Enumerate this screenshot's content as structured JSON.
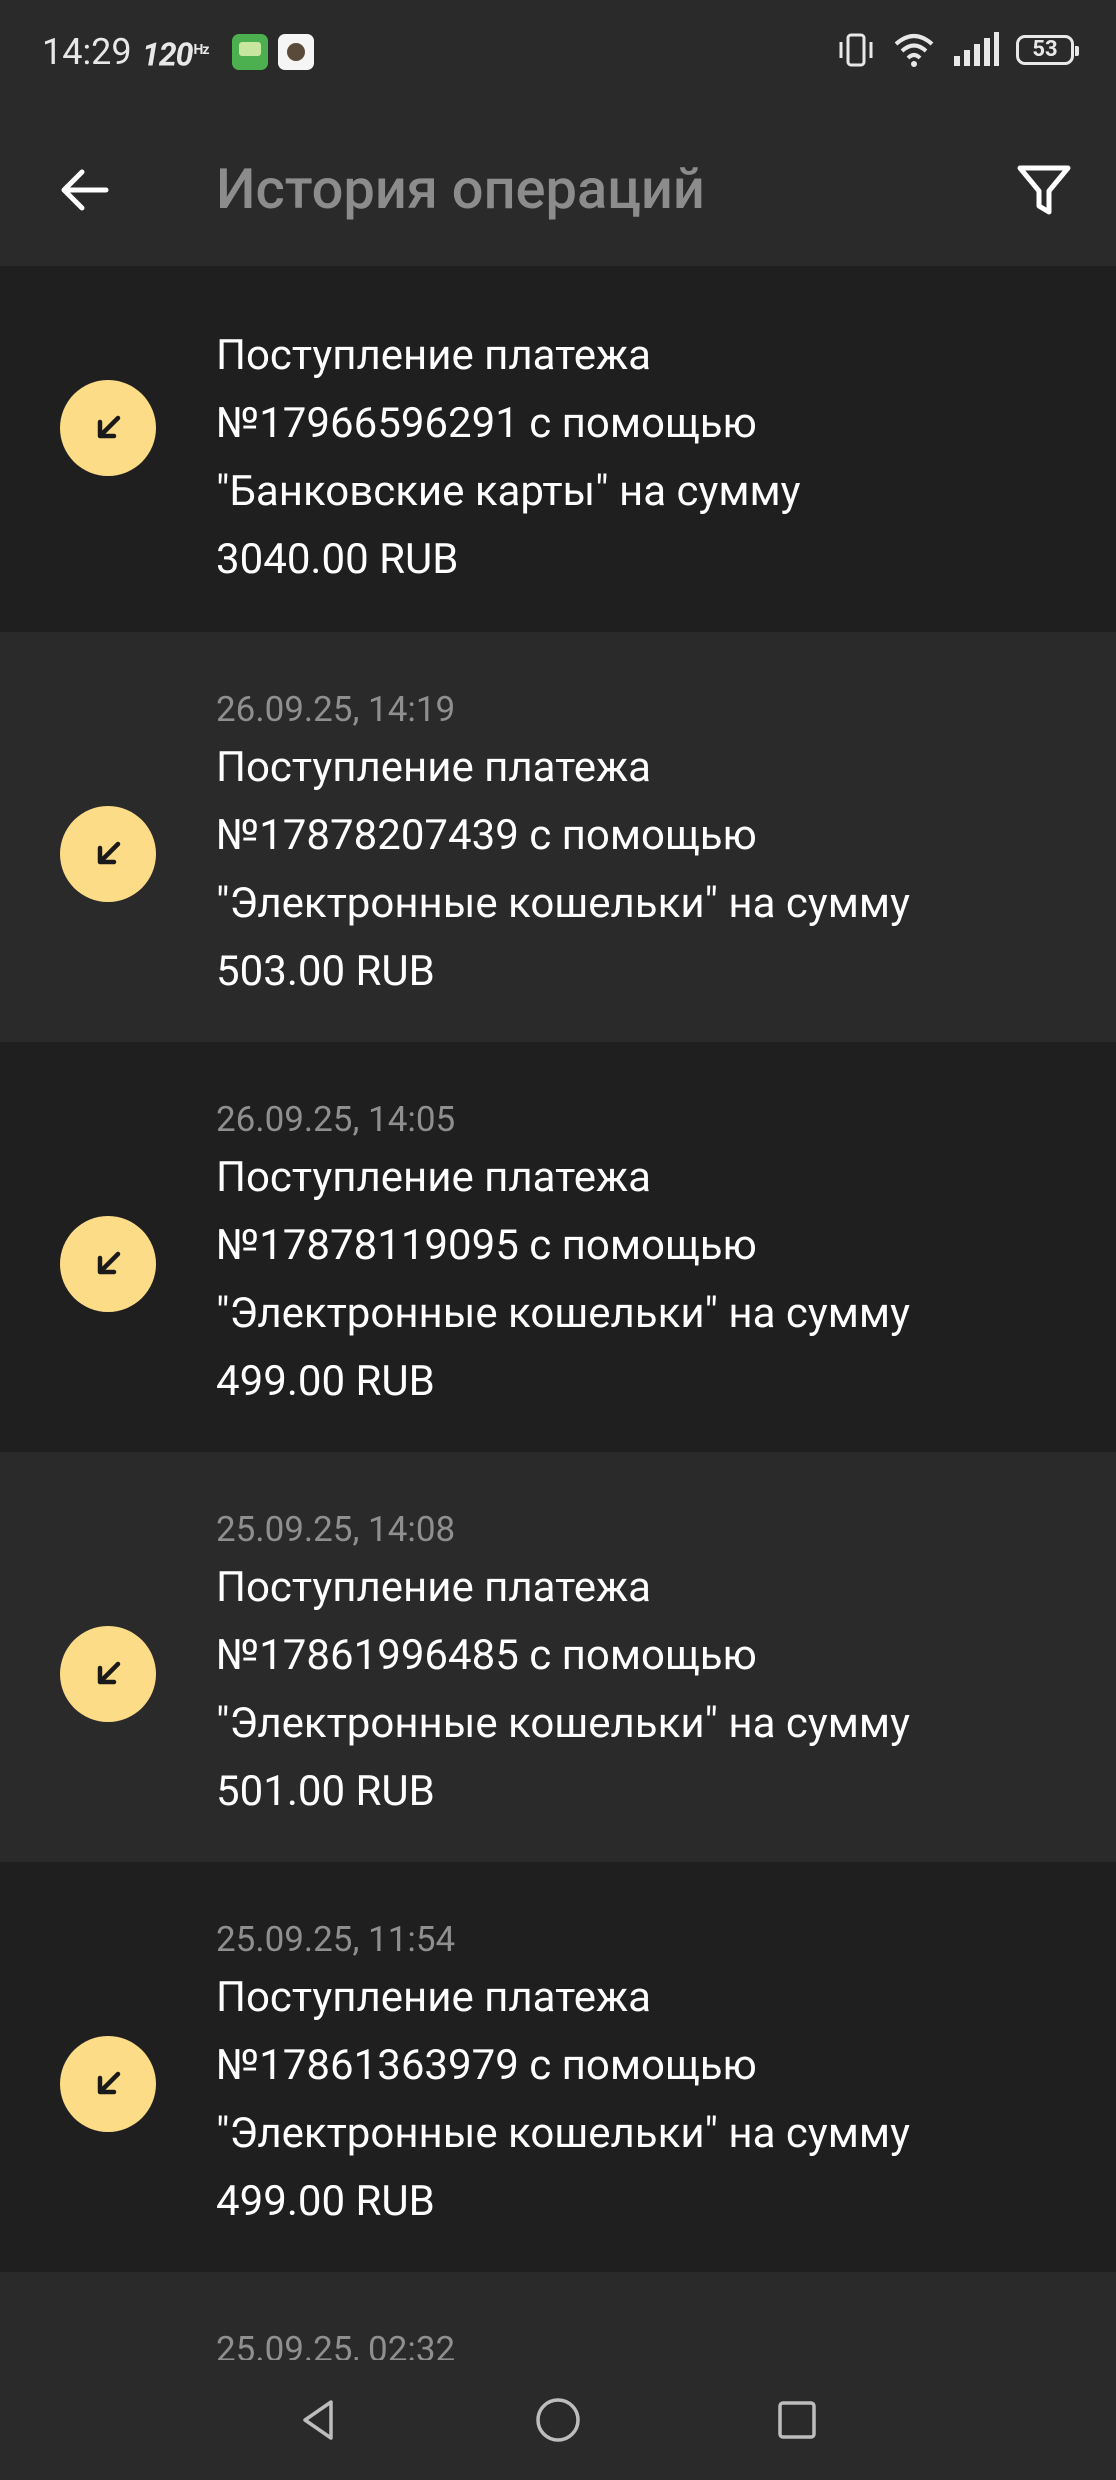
{
  "status_bar": {
    "time": "14:29",
    "refresh_rate": "120",
    "refresh_unit": "Hz",
    "battery": "53",
    "icons": [
      "vibrate-icon",
      "wifi-icon",
      "signal-icon",
      "battery-icon"
    ]
  },
  "header": {
    "title": "История операций",
    "back_icon": "arrow-left-icon",
    "filter_icon": "filter-icon"
  },
  "operations": [
    {
      "date": "",
      "description": "Поступление платежа\n№17966596291 с помощью\n\"Банковские карты\" на сумму\n3040.00 RUB"
    },
    {
      "date": "26.09.25, 14:19",
      "description": "Поступление платежа\n№17878207439 с помощью\n\"Электронные кошельки\" на сумму\n503.00 RUB"
    },
    {
      "date": "26.09.25, 14:05",
      "description": "Поступление платежа\n№17878119095 с помощью\n\"Электронные кошельки\" на сумму\n499.00 RUB"
    },
    {
      "date": "25.09.25, 14:08",
      "description": "Поступление платежа\n№17861996485 с помощью\n\"Электронные кошельки\" на сумму\n501.00 RUB"
    },
    {
      "date": "25.09.25, 11:54",
      "description": "Поступление платежа\n№17861363979 с помощью\n\"Электронные кошельки\" на сумму\n499.00 RUB"
    },
    {
      "date": "25.09.25, 02:32",
      "description": ""
    }
  ],
  "icon_color": "#fddc88",
  "nav_bar": {
    "icons": [
      "back-triangle-icon",
      "home-circle-icon",
      "recents-square-icon"
    ]
  }
}
